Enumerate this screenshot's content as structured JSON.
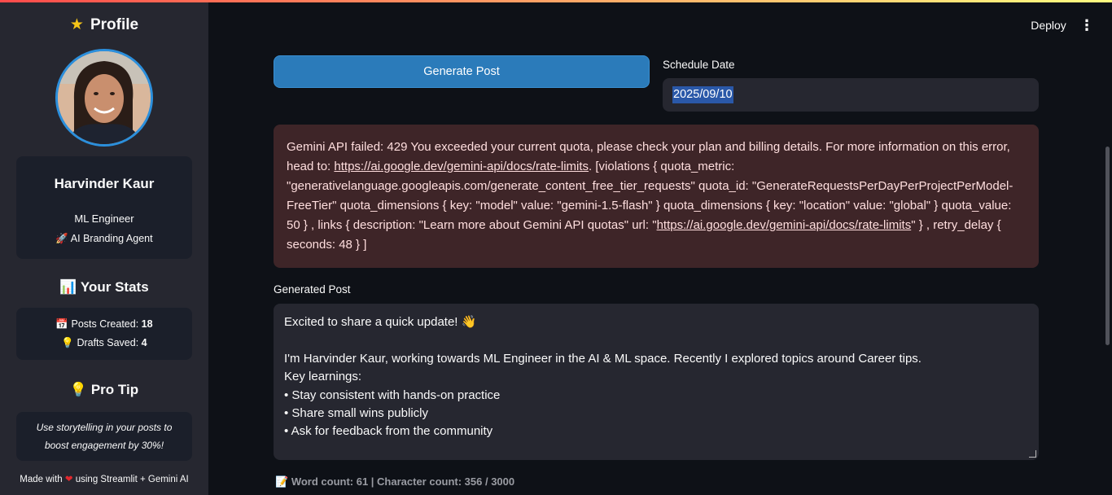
{
  "sidebar": {
    "title_icon": "★",
    "title": "Profile",
    "profile": {
      "name": "Harvinder Kaur",
      "role": "ML Engineer",
      "agent_icon": "🚀",
      "agent": "AI Branding Agent"
    },
    "stats": {
      "icon": "📊",
      "heading": "Your Stats",
      "posts_icon": "📅",
      "posts_label": "Posts Created:",
      "posts_value": "18",
      "drafts_icon": "💡",
      "drafts_label": "Drafts Saved:",
      "drafts_value": "4"
    },
    "tip": {
      "icon": "💡",
      "heading": "Pro Tip",
      "line1": "Use storytelling in your posts to",
      "line2": "boost engagement by 30%!"
    },
    "footer": {
      "prefix": "Made with",
      "heart": "❤",
      "suffix": "using Streamlit + Gemini AI"
    }
  },
  "header": {
    "deploy_label": "Deploy",
    "menu_icon": "⋮"
  },
  "main": {
    "generate_label": "Generate Post",
    "schedule_label": "Schedule Date",
    "schedule_value": "2025/09/10",
    "error": {
      "line1": "Gemini API failed: 429 You exceeded your current quota, please check your plan and billing details. For more information on this error,",
      "line2_prefix": "head to: ",
      "link": "https://ai.google.dev/gemini-api/docs/rate-limits",
      "line2_suffix": ". [violations { quota_metric:",
      "line3": "\"generativelanguage.googleapis.com/generate_content_free_tier_requests\" quota_id: \"GenerateRequestsPerDayPerProjectPerModel-",
      "line4": "FreeTier\" quota_dimensions { key: \"model\" value: \"gemini-1.5-flash\" } quota_dimensions { key: \"location\" value: \"global\" } quota_value:",
      "line5_prefix": "50 } , links { description: \"Learn more about Gemini API quotas\" url: \"",
      "line5_suffix": "\" } , retry_delay {",
      "line6": "seconds: 48 } ]"
    },
    "generated_label": "Generated Post",
    "post_lines": [
      "Excited to share a quick update! 👋",
      "",
      "I'm Harvinder Kaur, working towards ML Engineer in the AI & ML space. Recently I explored topics around Career tips.",
      "Key learnings:",
      "• Stay consistent with hands-on practice",
      "• Share small wins publicly",
      "• Ask for feedback from the community"
    ],
    "wordcount_icon": "📝",
    "wordcount": "Word count: 61 | Character count: 356 / 3000"
  }
}
